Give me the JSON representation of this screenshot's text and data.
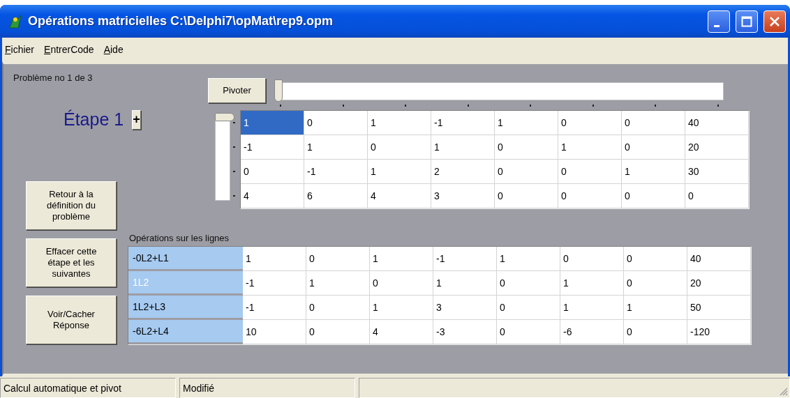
{
  "window": {
    "title": "Opérations matricielles C:\\Delphi7\\opMat\\rep9.opm"
  },
  "menu": [
    {
      "label": "Fichier"
    },
    {
      "label": "EntrerCode"
    },
    {
      "label": "Aide"
    }
  ],
  "problem_label": "Problème no 1 de 3",
  "step": {
    "label": "Étape 1",
    "add_button": "+"
  },
  "buttons": [
    "Retour à la définition du problème",
    "Effacer cette étape et les suivantes",
    "Voir/Cacher Réponse"
  ],
  "pivot_button": "Pivoter",
  "column_slider": {
    "level": 0
  },
  "matrix": [
    [
      {
        "value": "1",
        "selected": true
      },
      {
        "value": "0",
        "selected": false
      },
      {
        "value": "1",
        "selected": false
      },
      {
        "value": "-1",
        "selected": false
      },
      {
        "value": "1",
        "selected": false
      },
      {
        "value": "0",
        "selected": false
      },
      {
        "value": "0",
        "selected": false
      },
      {
        "value": "40",
        "selected": false
      }
    ],
    [
      {
        "value": "-1",
        "selected": false
      },
      {
        "value": "1",
        "selected": false
      },
      {
        "value": "0",
        "selected": false
      },
      {
        "value": "1",
        "selected": false
      },
      {
        "value": "0",
        "selected": false
      },
      {
        "value": "1",
        "selected": false
      },
      {
        "value": "0",
        "selected": false
      },
      {
        "value": "20",
        "selected": false
      }
    ],
    [
      {
        "value": "0",
        "selected": false
      },
      {
        "value": "-1",
        "selected": false
      },
      {
        "value": "1",
        "selected": false
      },
      {
        "value": "2",
        "selected": false
      },
      {
        "value": "0",
        "selected": false
      },
      {
        "value": "0",
        "selected": false
      },
      {
        "value": "1",
        "selected": false
      },
      {
        "value": "30",
        "selected": false
      }
    ],
    [
      {
        "value": "4",
        "selected": false
      },
      {
        "value": "6",
        "selected": false
      },
      {
        "value": "4",
        "selected": false
      },
      {
        "value": "3",
        "selected": false
      },
      {
        "value": "0",
        "selected": false
      },
      {
        "value": "0",
        "selected": false
      },
      {
        "value": "0",
        "selected": false
      },
      {
        "value": "0",
        "selected": false
      }
    ]
  ],
  "operations_label": "Opérations sur les lignes",
  "operations": [
    {
      "label": "-0L2+L1",
      "selected": false,
      "values": [
        "1",
        "0",
        "1",
        "-1",
        "1",
        "0",
        "0",
        "40"
      ]
    },
    {
      "label": "1L2",
      "selected": true,
      "values": [
        "-1",
        "1",
        "0",
        "1",
        "0",
        "1",
        "0",
        "20"
      ]
    },
    {
      "label": "1L2+L3",
      "selected": false,
      "values": [
        "-1",
        "0",
        "1",
        "3",
        "0",
        "1",
        "1",
        "50"
      ]
    },
    {
      "label": "-6L2+L4",
      "selected": false,
      "values": [
        "10",
        "0",
        "4",
        "-3",
        "0",
        "-6",
        "0",
        "-120"
      ]
    }
  ],
  "status_bar": [
    "Calcul automatique et pivot",
    "Modifié"
  ]
}
